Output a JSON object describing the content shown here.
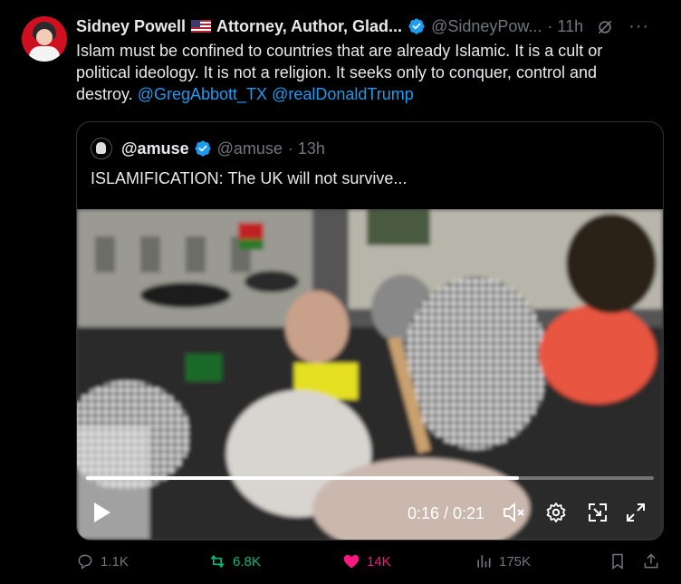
{
  "post": {
    "author_name": "Sidney Powell",
    "author_title": "Attorney, Author, Glad...",
    "handle": "@SidneyPow...",
    "time": "· 11h",
    "text": "Islam must be confined to countries that are already Islamic. It is a cult or political ideology. It is not a religion. It seeks only to conquer, control and destroy.",
    "mentions": [
      "@GregAbbott_TX",
      "@realDonaldTrump"
    ]
  },
  "quote": {
    "name": "@amuse",
    "handle": "@amuse",
    "time": "· 13h",
    "text": "ISLAMIFICATION: The UK will not survive..."
  },
  "video": {
    "time_display": "0:16 / 0:21",
    "progress": 0.762
  },
  "actions": {
    "replies": "1.1K",
    "reposts": "6.8K",
    "likes": "14K",
    "views": "175K"
  },
  "colors": {
    "accent": "#1d9bf0",
    "repost": "#00ba7c",
    "like": "#f91880",
    "muted": "#71767b"
  }
}
